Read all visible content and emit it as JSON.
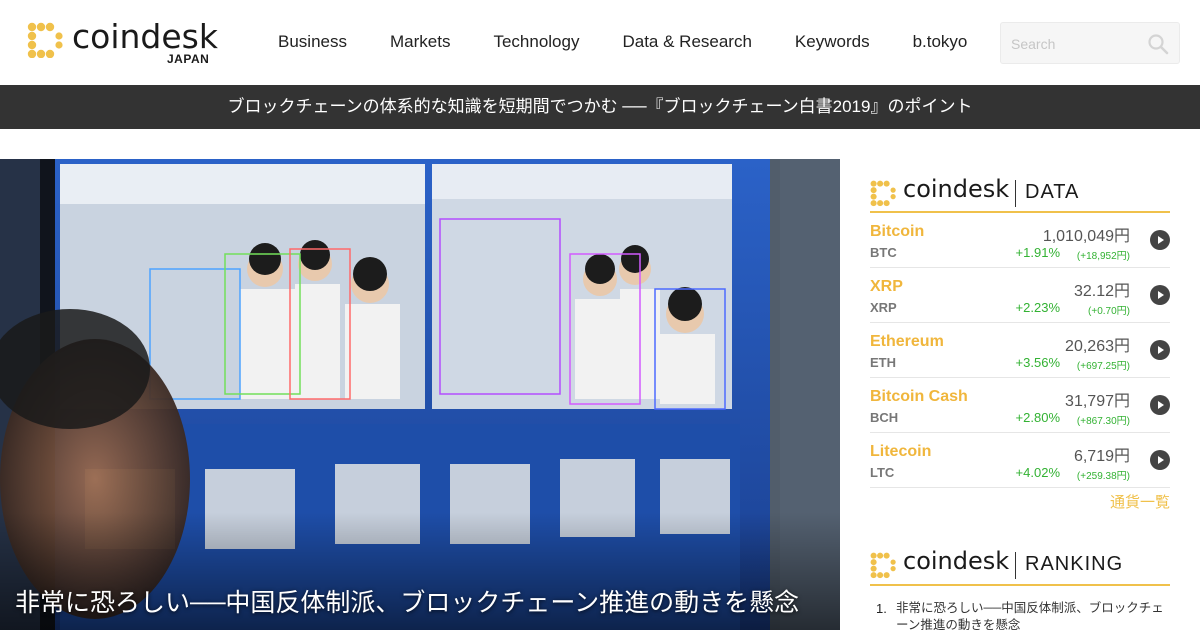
{
  "header": {
    "logo_text": "coindesk",
    "logo_sub": "JAPAN",
    "nav": [
      {
        "label": "Business"
      },
      {
        "label": "Markets"
      },
      {
        "label": "Technology"
      },
      {
        "label": "Data & Research"
      },
      {
        "label": "Keywords"
      },
      {
        "label": "b.tokyo"
      }
    ],
    "search_placeholder": "Search"
  },
  "banner": {
    "text": "ブロックチェーンの体系的な知識を短期間でつかむ ──『ブロックチェーン白書2019』のポイント"
  },
  "hero": {
    "title": "非常に恐ろしい──中国反体制派、ブロックチェーン推進の動きを懸念"
  },
  "data_panel": {
    "logo_text": "coindesk",
    "label": "DATA",
    "coins": [
      {
        "name": "Bitcoin",
        "symbol": "BTC",
        "price": "1,010,049円",
        "change_pct": "+1.91%",
        "change_abs": "(+18,952円)"
      },
      {
        "name": "XRP",
        "symbol": "XRP",
        "price": "32.12円",
        "change_pct": "+2.23%",
        "change_abs": "(+0.70円)"
      },
      {
        "name": "Ethereum",
        "symbol": "ETH",
        "price": "20,263円",
        "change_pct": "+3.56%",
        "change_abs": "(+697.25円)"
      },
      {
        "name": "Bitcoin Cash",
        "symbol": "BCH",
        "price": "31,797円",
        "change_pct": "+2.80%",
        "change_abs": "(+867.30円)"
      },
      {
        "name": "Litecoin",
        "symbol": "LTC",
        "price": "6,719円",
        "change_pct": "+4.02%",
        "change_abs": "(+259.38円)"
      }
    ],
    "more_link": "通貨一覧"
  },
  "ranking_panel": {
    "logo_text": "coindesk",
    "label": "RANKING",
    "items": [
      {
        "num": "1.",
        "title": "非常に恐ろしい──中国反体制派、ブロックチェーン推進の動きを懸念"
      }
    ]
  },
  "colors": {
    "brand_yellow": "#f0c14b",
    "banner_bg": "#333333",
    "positive_green": "#33b233"
  }
}
